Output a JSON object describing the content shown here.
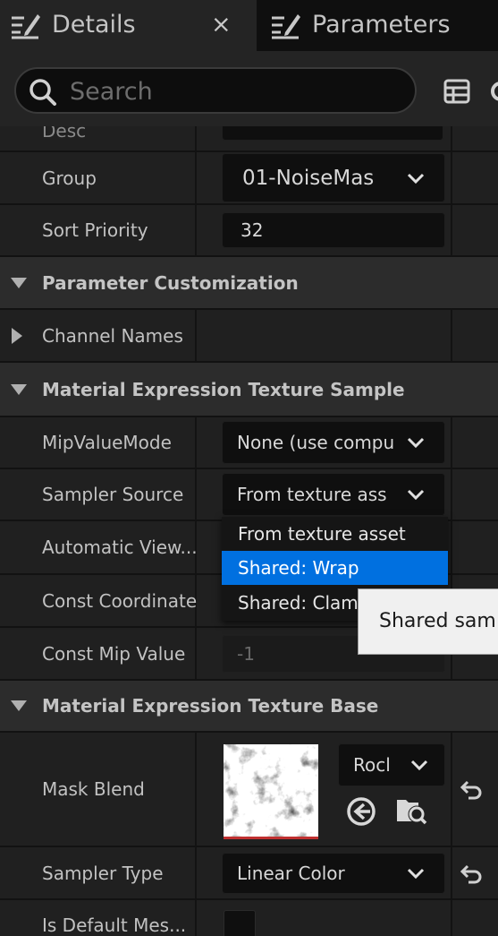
{
  "tabs": {
    "details_label": "Details",
    "close_glyph": "×",
    "parameters_label": "Parameters"
  },
  "search": {
    "placeholder": "Search"
  },
  "rows": {
    "desc_label": "Desc",
    "group_label": "Group",
    "group_value": "01-NoiseMas",
    "sort_priority_label": "Sort Priority",
    "sort_priority_value": "32"
  },
  "categories": {
    "parameter_customization": "Parameter Customization",
    "texture_sample": "Material Expression Texture Sample",
    "texture_base": "Material Expression Texture Base"
  },
  "parameter_customization": {
    "channel_names_label": "Channel Names"
  },
  "texture_sample": {
    "mip_value_mode_label": "MipValueMode",
    "mip_value_mode_value": "None (use compu",
    "sampler_source_label": "Sampler Source",
    "sampler_source_value": "From texture ass",
    "automatic_view_label": "Automatic View...",
    "const_coordinate_label": "Const Coordinate",
    "const_mip_value_label": "Const Mip Value",
    "const_mip_value_value": "-1"
  },
  "dropdown": {
    "options": [
      "From texture asset",
      "Shared: Wrap",
      "Shared: Clam"
    ],
    "selected_index": 1
  },
  "tooltip": {
    "text": "Shared sam"
  },
  "texture_base": {
    "mask_blend_label": "Mask Blend",
    "asset_combo_value": "Rocl",
    "sampler_type_label": "Sampler Type",
    "sampler_type_value": "Linear Color",
    "is_default_mesh_label": "Is Default Mes..."
  },
  "colors": {
    "accent_selection": "#0070e0",
    "thumbnail_underline": "#c03030"
  },
  "icons": [
    "details-icon",
    "parameters-icon",
    "search-icon",
    "table-icon",
    "gear-icon",
    "chevron-down-icon",
    "collapse-arrow-icon",
    "expand-arrow-icon",
    "use-selected-asset-icon",
    "browse-asset-icon",
    "reset-to-default-icon"
  ]
}
